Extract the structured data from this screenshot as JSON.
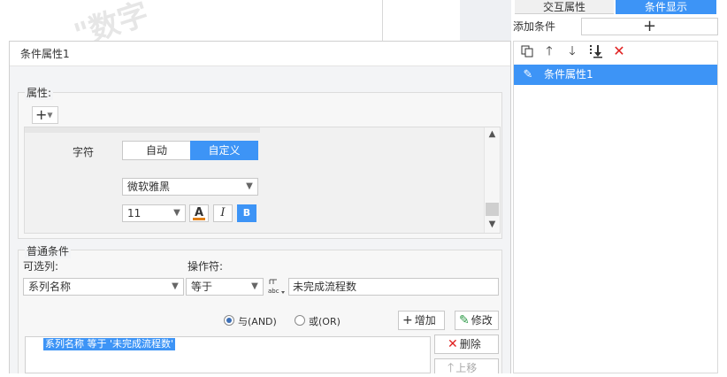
{
  "watermark": "\"数字",
  "right_panel": {
    "tabs": [
      "交互属性",
      "条件显示"
    ],
    "add_condition_label": "添加条件",
    "add_condition_button": "+",
    "toolbar_icons": [
      "copy-icon",
      "move-up-icon",
      "move-down-icon",
      "move-bottom-icon",
      "delete-icon"
    ],
    "conditions": [
      "条件属性1"
    ]
  },
  "dialog": {
    "title": "条件属性1",
    "properties": {
      "label": "属性:",
      "add_button": "+",
      "char_label": "字符",
      "mode_options": [
        "自动",
        "自定义"
      ],
      "mode_selected": "自定义",
      "font_family": "微软雅黑",
      "font_size": "11",
      "font_color_button": "A",
      "italic_button": "I",
      "bold_button": "B",
      "colors": {
        "accent": "#3d94f6",
        "font_color_bar": "#e07f16"
      }
    },
    "common": {
      "label": "普通条件",
      "column_label": "可选列:",
      "operator_label": "操作符:",
      "column_value": "系列名称",
      "operator_value": "等于",
      "value_type_icon": "abc",
      "value": "未完成流程数",
      "and_label": "与(AND)",
      "or_label": "或(OR)",
      "selected_logic": "and",
      "add_button": "增加",
      "modify_button": "修改",
      "delete_button": "删除",
      "move_up_button": "上移",
      "list_items": [
        "系列名称 等于 '未完成流程数'"
      ]
    }
  }
}
